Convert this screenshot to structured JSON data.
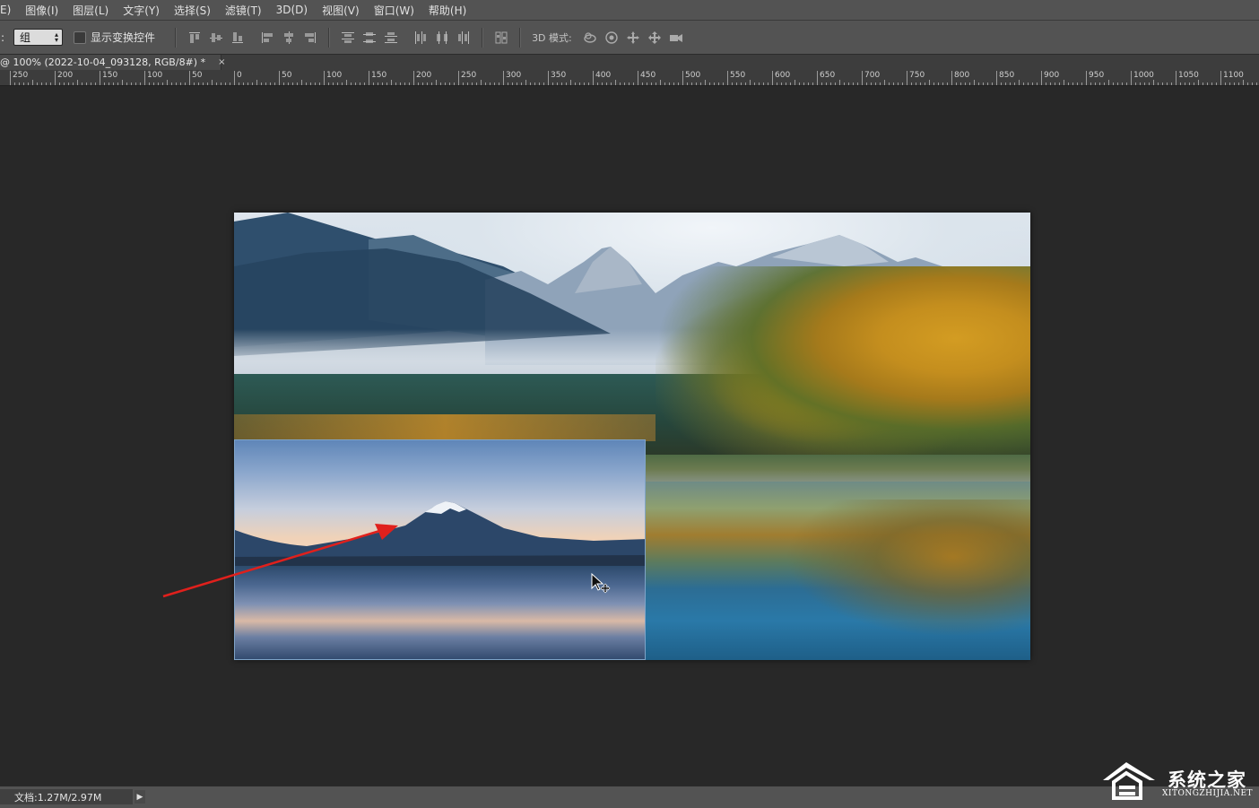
{
  "menubar": {
    "items": [
      "E)",
      "图像(I)",
      "图层(L)",
      "文字(Y)",
      "选择(S)",
      "滤镜(T)",
      "3D(D)",
      "视图(V)",
      "窗口(W)",
      "帮助(H)"
    ]
  },
  "options": {
    "colon": ":",
    "auto_select_value": "组",
    "show_transform_label": "显示变换控件",
    "show_transform_checked": false,
    "mode_label": "3D 模式:"
  },
  "document_tab": {
    "title": "@ 100% (2022-10-04_093128, RGB/8#) *",
    "close": "×"
  },
  "ruler": {
    "labels": [
      "250",
      "200",
      "150",
      "100",
      "50",
      "0",
      "50",
      "100",
      "150",
      "200",
      "250",
      "300",
      "350",
      "400",
      "450",
      "500",
      "550",
      "600",
      "650",
      "700",
      "750",
      "800",
      "850",
      "900",
      "950",
      "1000",
      "1050",
      "1100"
    ]
  },
  "status": {
    "doc_info": "文档:1.27M/2.97M",
    "arrow": "▶"
  },
  "watermark": {
    "cn": "系统之家",
    "en": "XITONGZHIJIA.NET"
  },
  "colors": {
    "menubar_bg": "#535353",
    "workspace_bg": "#282828",
    "arrow_red": "#e0201c"
  }
}
